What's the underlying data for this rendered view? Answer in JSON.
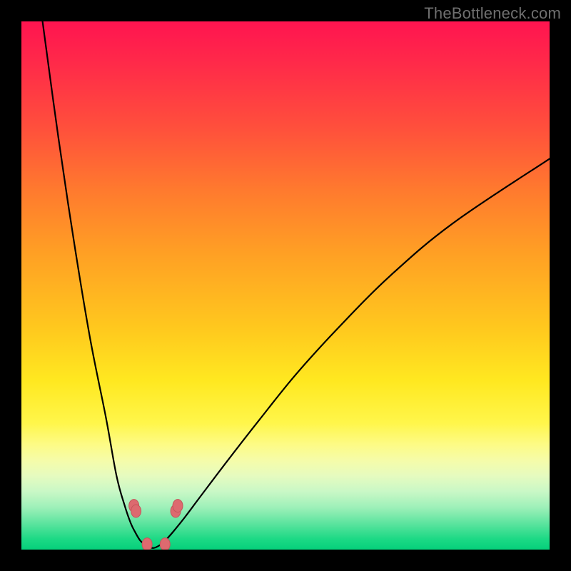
{
  "watermark": "TheBottleneck.com",
  "colors": {
    "page_bg": "#000000",
    "curve": "#000000",
    "marker_fill": "#dd6a6f",
    "marker_stroke": "#c4565b",
    "gradient_top": "#ff1450",
    "gradient_bottom": "#06d07b"
  },
  "chart_data": {
    "type": "line",
    "title": "",
    "xlabel": "",
    "ylabel": "",
    "xlim": [
      0,
      100
    ],
    "ylim": [
      0,
      100
    ],
    "notch_x": 25,
    "series": [
      {
        "name": "left-branch",
        "x": [
          4.0,
          7.0,
          10.0,
          13.0,
          16.0,
          18.0,
          19.5,
          20.7,
          21.7,
          22.5,
          23.3,
          24.2,
          25.0
        ],
        "values": [
          100,
          78,
          58,
          40,
          25,
          14,
          8.5,
          5.0,
          3.0,
          1.7,
          1.0,
          0.5,
          0.3
        ]
      },
      {
        "name": "right-branch",
        "x": [
          25.0,
          25.8,
          26.7,
          27.7,
          29.0,
          31.0,
          34.0,
          39.0,
          45.0,
          52.0,
          60.0,
          70.0,
          82.0,
          100.0
        ],
        "values": [
          0.3,
          0.6,
          1.2,
          2.2,
          3.7,
          6.2,
          10.2,
          16.8,
          24.5,
          33.2,
          42.0,
          52.0,
          62.0,
          74.0
        ]
      }
    ],
    "markers": [
      {
        "name": "left-upper-1",
        "x": 21.3,
        "y": 8.3
      },
      {
        "name": "left-upper-2",
        "x": 21.7,
        "y": 7.3
      },
      {
        "name": "left-lower",
        "x": 23.8,
        "y": 1.0
      },
      {
        "name": "right-lower",
        "x": 27.2,
        "y": 1.0
      },
      {
        "name": "right-upper-1",
        "x": 29.2,
        "y": 7.3
      },
      {
        "name": "right-upper-2",
        "x": 29.6,
        "y": 8.3
      }
    ]
  }
}
